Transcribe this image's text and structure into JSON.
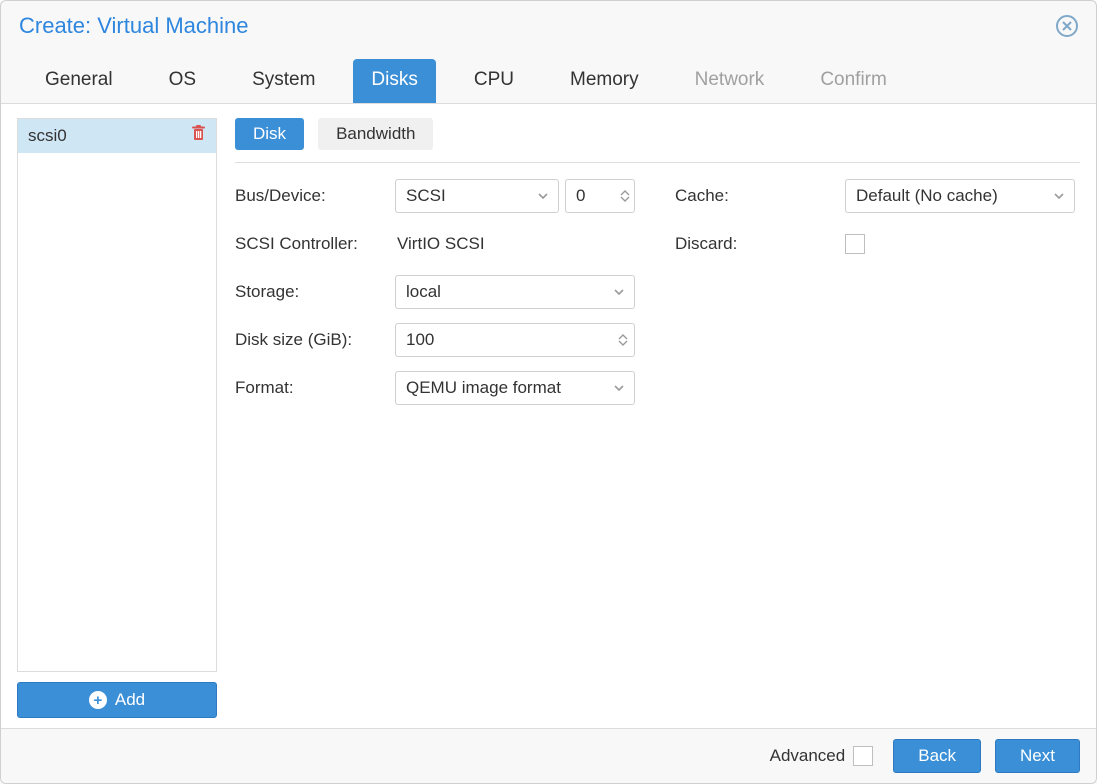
{
  "window": {
    "title": "Create: Virtual Machine"
  },
  "tabs": {
    "items": [
      {
        "label": "General",
        "state": "enabled"
      },
      {
        "label": "OS",
        "state": "enabled"
      },
      {
        "label": "System",
        "state": "enabled"
      },
      {
        "label": "Disks",
        "state": "active"
      },
      {
        "label": "CPU",
        "state": "enabled"
      },
      {
        "label": "Memory",
        "state": "enabled"
      },
      {
        "label": "Network",
        "state": "disabled"
      },
      {
        "label": "Confirm",
        "state": "disabled"
      }
    ]
  },
  "disklist": {
    "items": [
      {
        "label": "scsi0"
      }
    ],
    "add_label": "Add"
  },
  "subtabs": {
    "items": [
      {
        "label": "Disk",
        "state": "active"
      },
      {
        "label": "Bandwidth",
        "state": "inactive"
      }
    ]
  },
  "fields": {
    "bus_label": "Bus/Device:",
    "bus_value": "SCSI",
    "bus_index": "0",
    "scsi_ctrl_label": "SCSI Controller:",
    "scsi_ctrl_value": "VirtIO SCSI",
    "storage_label": "Storage:",
    "storage_value": "local",
    "disksize_label": "Disk size (GiB):",
    "disksize_value": "100",
    "format_label": "Format:",
    "format_value": "QEMU image format",
    "cache_label": "Cache:",
    "cache_value": "Default (No cache)",
    "discard_label": "Discard:"
  },
  "footer": {
    "advanced_label": "Advanced",
    "back_label": "Back",
    "next_label": "Next"
  }
}
